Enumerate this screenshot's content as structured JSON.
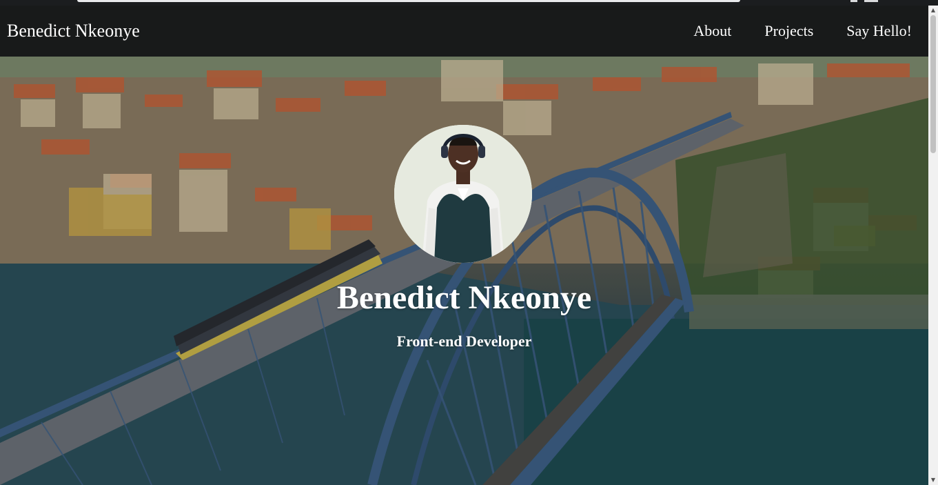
{
  "navbar": {
    "brand": "Benedict Nkeonye",
    "links": [
      "About",
      "Projects",
      "Say Hello!"
    ]
  },
  "hero": {
    "name": "Benedict Nkeonye",
    "role": "Front-end Developer"
  },
  "colors": {
    "navbar_bg": "#181a1a",
    "text": "#ffffff",
    "bridge": "#3d5f86",
    "river": "#1f4a55",
    "roofs": "#c4623a"
  },
  "icons": {
    "scroll_up": "up-arrow-icon",
    "scroll_down": "down-arrow-icon"
  }
}
